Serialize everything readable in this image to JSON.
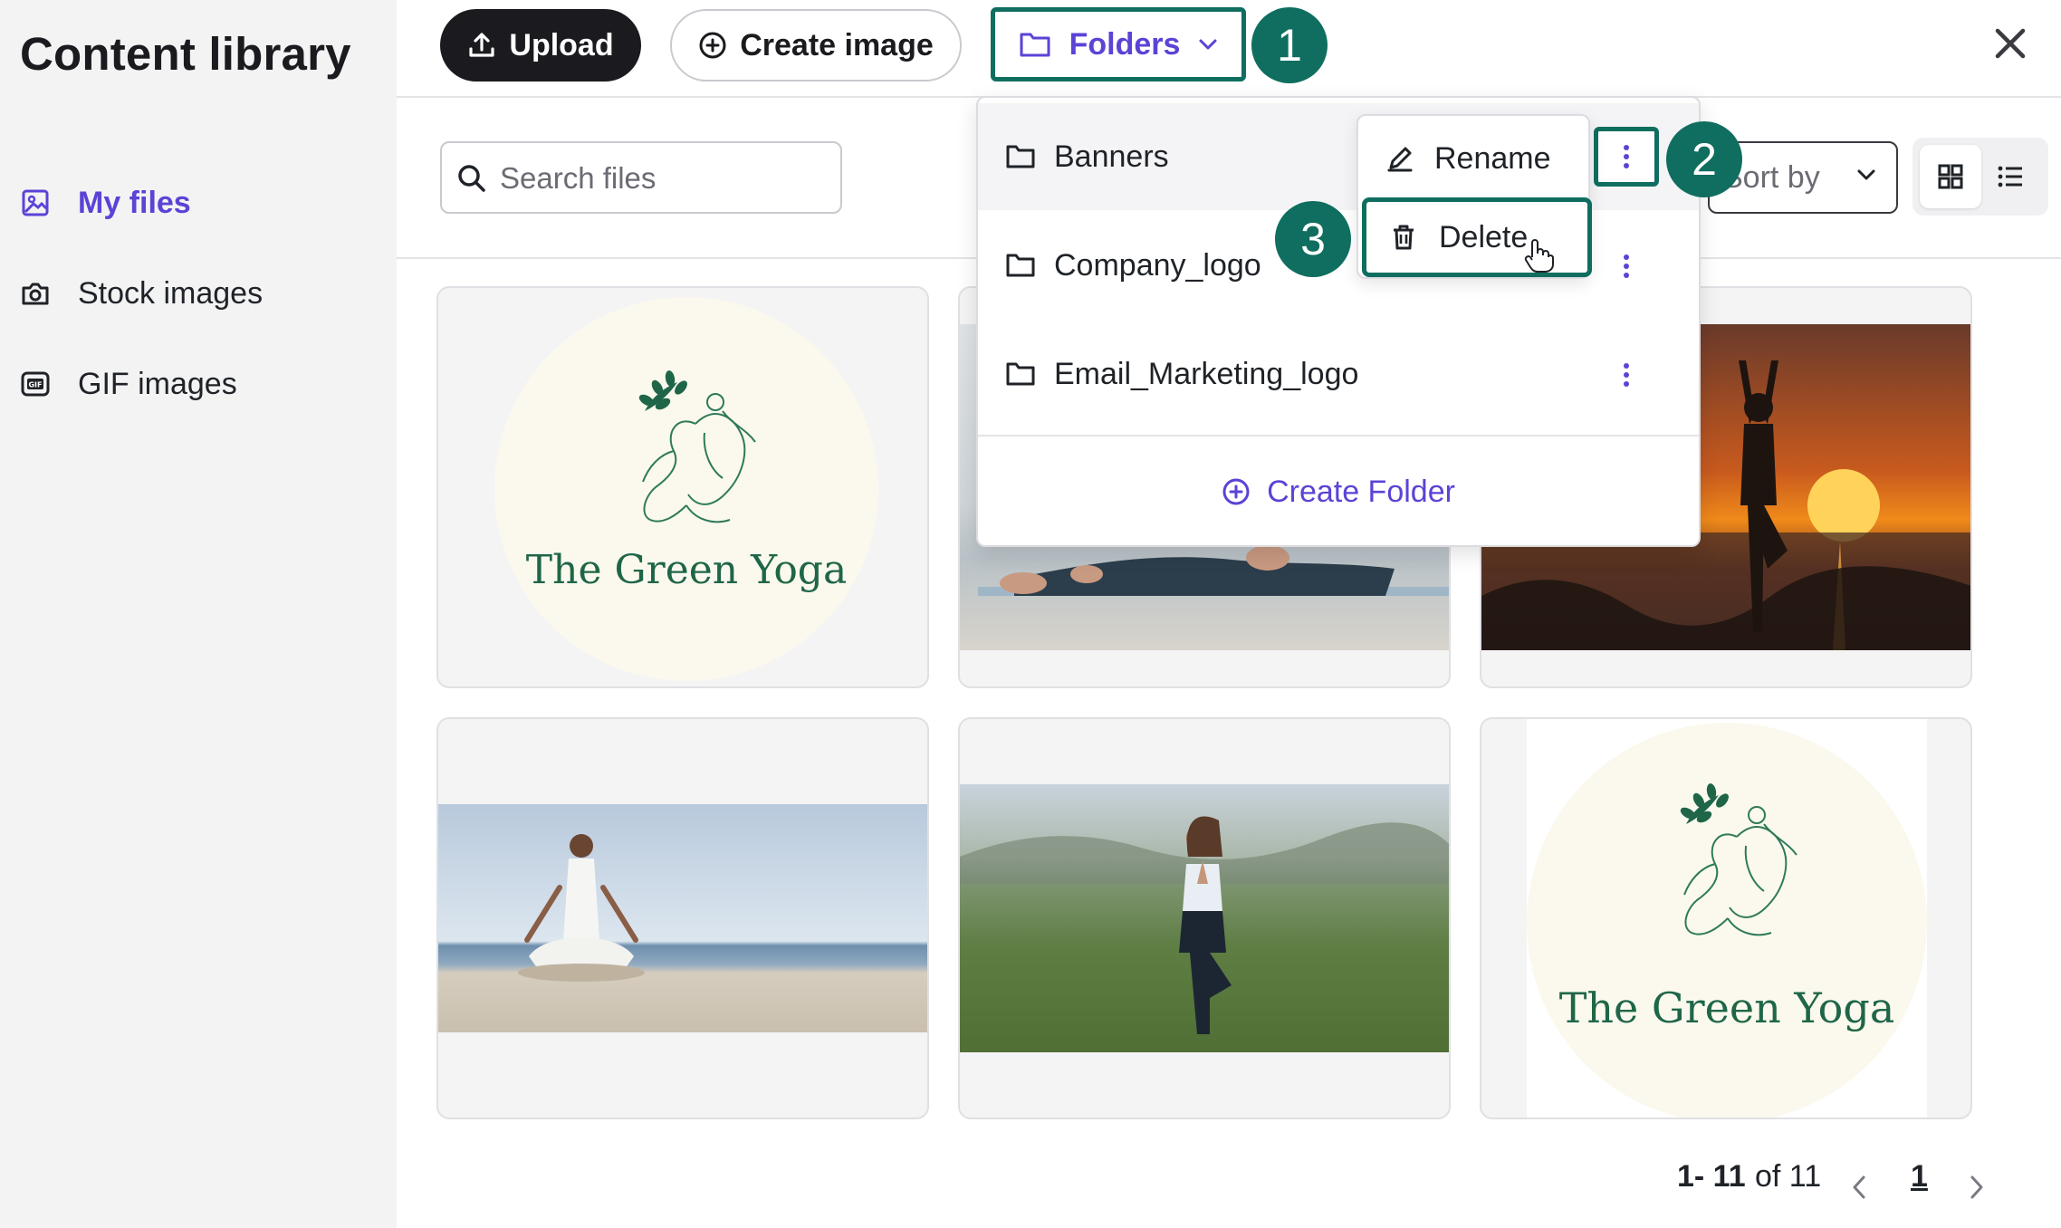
{
  "sidebar": {
    "title": "Content library",
    "items": [
      {
        "label": "My files",
        "icon": "image-icon",
        "active": true
      },
      {
        "label": "Stock images",
        "icon": "camera-icon",
        "active": false
      },
      {
        "label": "GIF images",
        "icon": "gif-icon",
        "active": false
      }
    ]
  },
  "header": {
    "upload_label": "Upload",
    "create_image_label": "Create image",
    "folders_label": "Folders"
  },
  "callouts": [
    "1",
    "2",
    "3"
  ],
  "toolbar": {
    "search_placeholder": "Search files",
    "sort_label": "Sort by"
  },
  "folders_menu": {
    "folders": [
      "Banners",
      "Company_logo",
      "Email_Marketing_logo"
    ],
    "create_folder_label": "Create Folder",
    "context_menu": {
      "rename_label": "Rename",
      "delete_label": "Delete"
    }
  },
  "gallery": {
    "logo_text": "The Green Yoga",
    "items": [
      {
        "kind": "logo"
      },
      {
        "kind": "photo",
        "subject": "woman stretching on yoga mat"
      },
      {
        "kind": "photo",
        "subject": "tree pose at sunset"
      },
      {
        "kind": "photo",
        "subject": "lotus pose on beach"
      },
      {
        "kind": "photo",
        "subject": "tree pose in meadow"
      },
      {
        "kind": "logo"
      }
    ]
  },
  "pagination": {
    "range": "1- 11",
    "of_total": "of 11",
    "current_page": "1"
  },
  "colors": {
    "accent": "#5b43d6",
    "callout": "#0f6e5f",
    "sidebar_bg": "#f3f3f4",
    "primary_button": "#1b1b1f"
  }
}
